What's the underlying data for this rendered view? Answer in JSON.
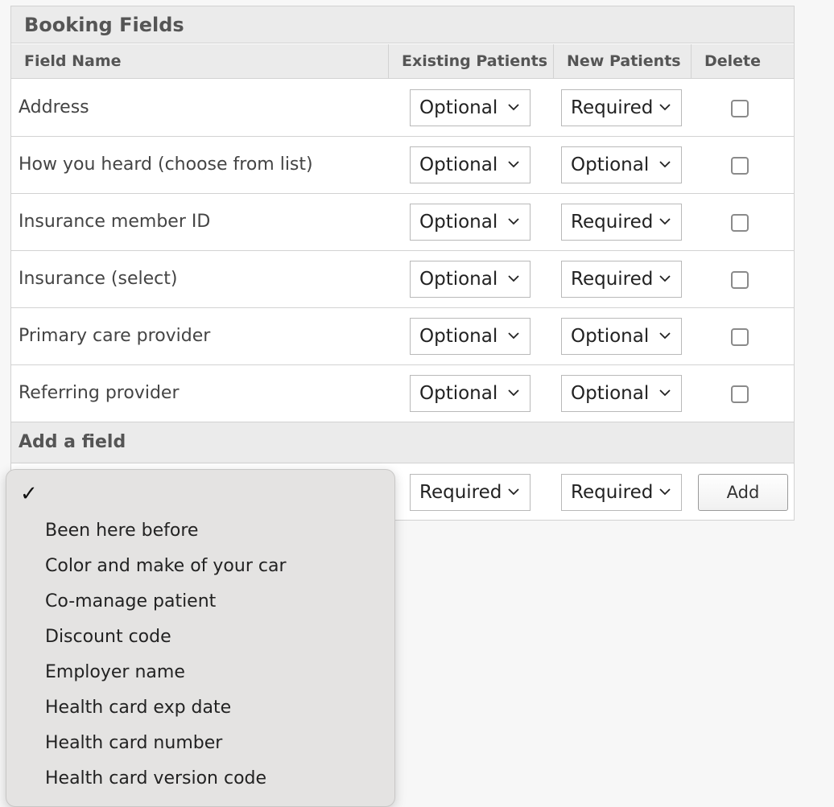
{
  "panel": {
    "title": "Booking Fields",
    "columns": {
      "field_name": "Field Name",
      "existing": "Existing Patients",
      "new": "New Patients",
      "delete": "Delete"
    }
  },
  "rows": [
    {
      "name": "Address",
      "existing": "Optional",
      "new": "Required",
      "delete": false
    },
    {
      "name": "How you heard (choose from list)",
      "existing": "Optional",
      "new": "Optional",
      "delete": false
    },
    {
      "name": "Insurance member ID",
      "existing": "Optional",
      "new": "Required",
      "delete": false
    },
    {
      "name": "Insurance (select)",
      "existing": "Optional",
      "new": "Required",
      "delete": false
    },
    {
      "name": "Primary care provider",
      "existing": "Optional",
      "new": "Optional",
      "delete": false
    },
    {
      "name": "Referring provider",
      "existing": "Optional",
      "new": "Optional",
      "delete": false
    }
  ],
  "add_field": {
    "heading": "Add a field",
    "existing": "Required",
    "new": "Required",
    "button": "Add"
  },
  "dropdown": {
    "check": "✓",
    "options": [
      "Been here before",
      "Color and make of your car",
      "Co-manage patient",
      "Discount code",
      "Employer name",
      "Health card exp date",
      "Health card number",
      "Health card version code"
    ]
  },
  "icons": {
    "select_arrow": "chevron-down-icon",
    "dropdown_check": "checkmark-icon"
  }
}
